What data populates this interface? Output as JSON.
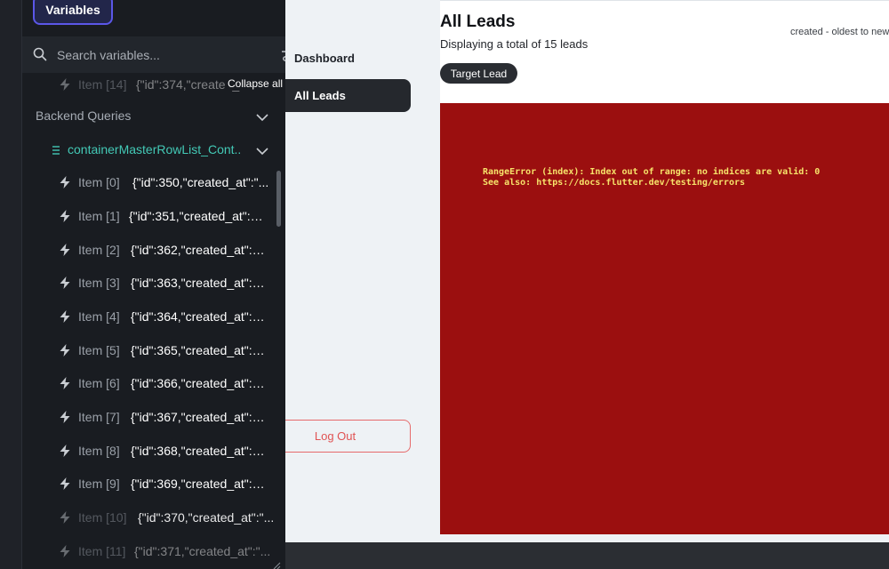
{
  "variables_panel": {
    "tab_label": "Variables",
    "search_placeholder": "Search variables...",
    "collapse_all": "Collapse all",
    "top_item": {
      "label": "Item [14]",
      "value": "{\"id\":374,\"created_at\":\"2"
    },
    "section_label": "Backend Queries",
    "query_label": "containerMasterRowList_Cont...",
    "items": [
      {
        "label": "Item [0]",
        "value": "{\"id\":350,\"created_at\":\"..."
      },
      {
        "label": "Item [1]",
        "value": "{\"id\":351,\"created_at\":\"2..."
      },
      {
        "label": "Item [2]",
        "value": "{\"id\":362,\"created_at\":\"2..."
      },
      {
        "label": "Item [3]",
        "value": "{\"id\":363,\"created_at\":\"2..."
      },
      {
        "label": "Item [4]",
        "value": "{\"id\":364,\"created_at\":\"2..."
      },
      {
        "label": "Item [5]",
        "value": "{\"id\":365,\"created_at\":\"2..."
      },
      {
        "label": "Item [6]",
        "value": "{\"id\":366,\"created_at\":\"2..."
      },
      {
        "label": "Item [7]",
        "value": "{\"id\":367,\"created_at\":\"2..."
      },
      {
        "label": "Item [8]",
        "value": "{\"id\":368,\"created_at\":\"2..."
      },
      {
        "label": "Item [9]",
        "value": "{\"id\":369,\"created_at\":\"2..."
      },
      {
        "label": "Item [10]",
        "value": "{\"id\":370,\"created_at\":\"..."
      },
      {
        "label": "Item [11]",
        "value": "{\"id\":371,\"created_at\":\"..."
      }
    ]
  },
  "app_nav": {
    "dashboard": "Dashboard",
    "all_leads": "All Leads",
    "logout": "Log Out"
  },
  "main": {
    "title": "All Leads",
    "subtitle": "Displaying a total of 15 leads",
    "sort_label": "created - oldest to newe",
    "target_button": "Target Lead",
    "error_line1": "RangeError (index): Index out of range: no indices are valid: 0",
    "error_line2": "See also: https://docs.flutter.dev/testing/errors"
  },
  "colors": {
    "panel_bg": "#191c21",
    "accent_purple": "#5b57e8",
    "query_teal": "#43c9b6",
    "error_bg": "#9b0f0f",
    "error_text": "#f7e36a",
    "logout_red": "#e05353"
  },
  "icons": {
    "search": "search-icon",
    "filter": "filter-icon",
    "bolt": "bolt-icon",
    "chevron": "chevron-down-icon",
    "list": "list-icon",
    "grip": "resize-grip-icon"
  }
}
